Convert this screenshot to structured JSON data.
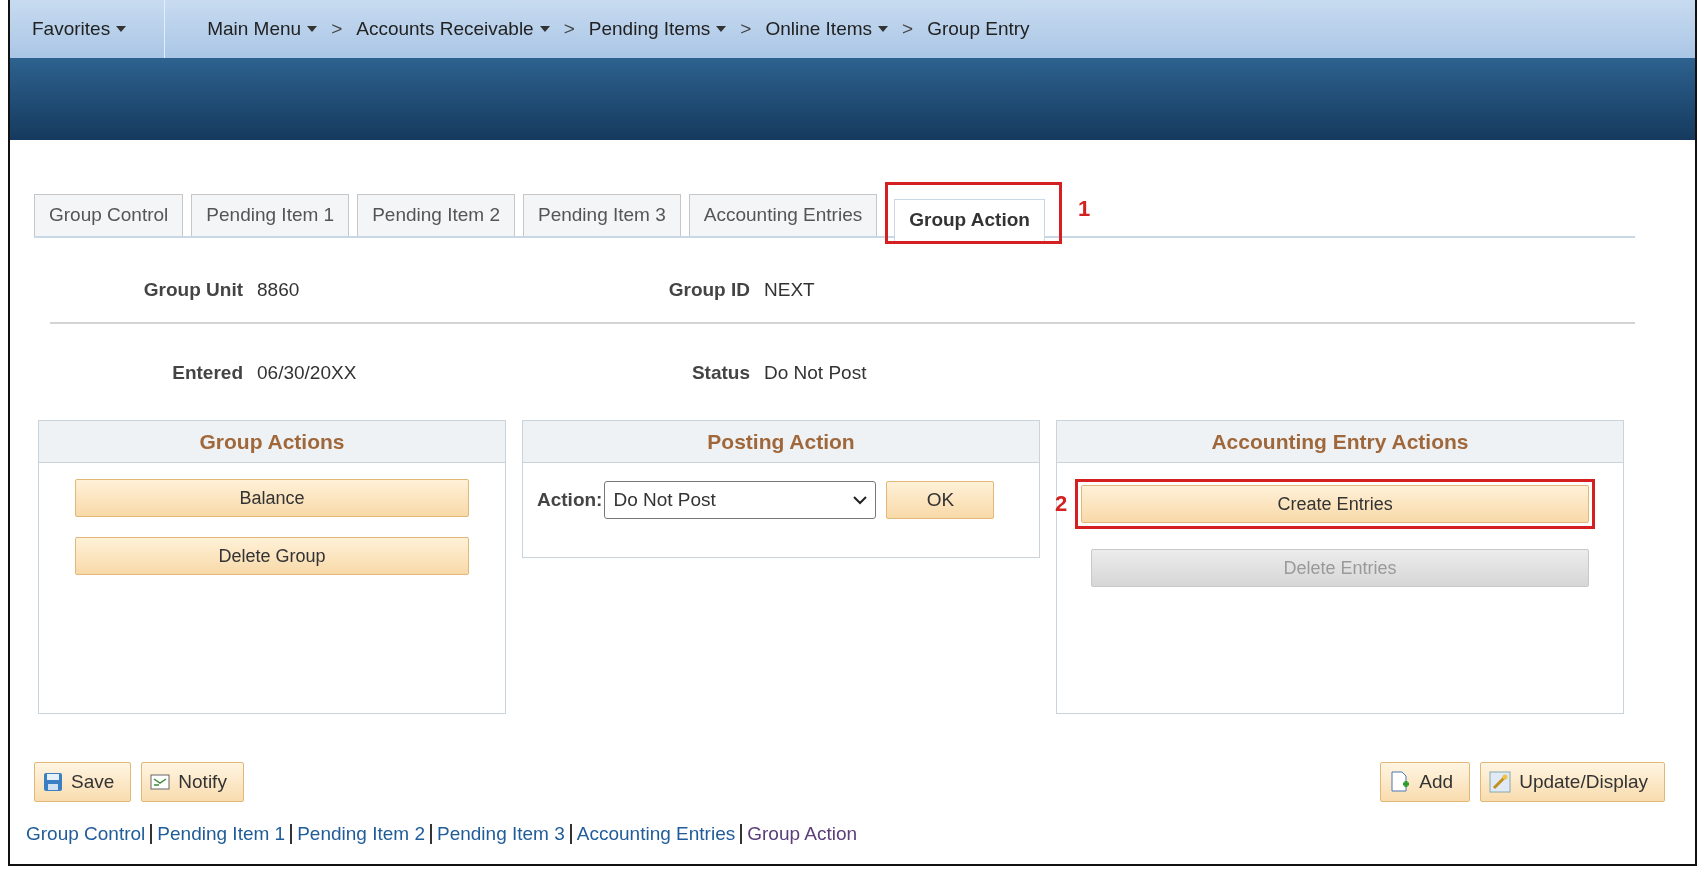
{
  "nav": [
    {
      "label": "Favorites",
      "dropdown": true
    },
    {
      "label": "Main Menu",
      "dropdown": true
    },
    {
      "label": "Accounts Receivable",
      "dropdown": true,
      "separator": ">"
    },
    {
      "label": "Pending Items",
      "dropdown": true,
      "separator": ">"
    },
    {
      "label": "Online Items",
      "dropdown": true,
      "separator": ">"
    },
    {
      "label": "Group Entry",
      "dropdown": false,
      "separator": ">"
    }
  ],
  "tabs": [
    {
      "label": "Group Control",
      "selected": false
    },
    {
      "label": "Pending Item 1",
      "selected": false
    },
    {
      "label": "Pending Item 2",
      "selected": false
    },
    {
      "label": "Pending Item 3",
      "selected": false
    },
    {
      "label": "Accounting Entries",
      "selected": false
    },
    {
      "label": "Group Action",
      "selected": true,
      "callout": "1"
    }
  ],
  "fields": [
    [
      {
        "label": "Group Unit",
        "value": "8860"
      },
      {
        "label": "Group ID",
        "value": "NEXT"
      }
    ],
    [
      {
        "label": "Entered",
        "value": "06/30/20XX"
      },
      {
        "label": "Status",
        "value": "Do Not Post"
      }
    ]
  ],
  "panels": [
    {
      "title": "Group Actions",
      "kind": "buttons",
      "buttons": [
        {
          "label": "Balance",
          "disabled": false
        },
        {
          "label": "Delete Group",
          "disabled": false
        }
      ]
    },
    {
      "title": "Posting Action",
      "kind": "select",
      "label": "Action:",
      "value": "Do Not Post",
      "button": "OK"
    },
    {
      "title": "Accounting Entry Actions",
      "kind": "buttons",
      "buttons": [
        {
          "label": "Create Entries",
          "disabled": false,
          "callout": "2"
        },
        {
          "label": "Delete Entries",
          "disabled": true
        }
      ]
    }
  ],
  "toolbar_left": [
    "Save",
    "Notify"
  ],
  "toolbar_right": [
    "Add",
    "Update/Display"
  ],
  "links": [
    {
      "label": "Group Control",
      "selected": false
    },
    {
      "label": "Pending Item 1",
      "selected": false
    },
    {
      "label": "Pending Item 2",
      "selected": false
    },
    {
      "label": "Pending Item 3",
      "selected": false
    },
    {
      "label": "Accounting Entries",
      "selected": false
    },
    {
      "label": "Group Action",
      "selected": true
    }
  ]
}
